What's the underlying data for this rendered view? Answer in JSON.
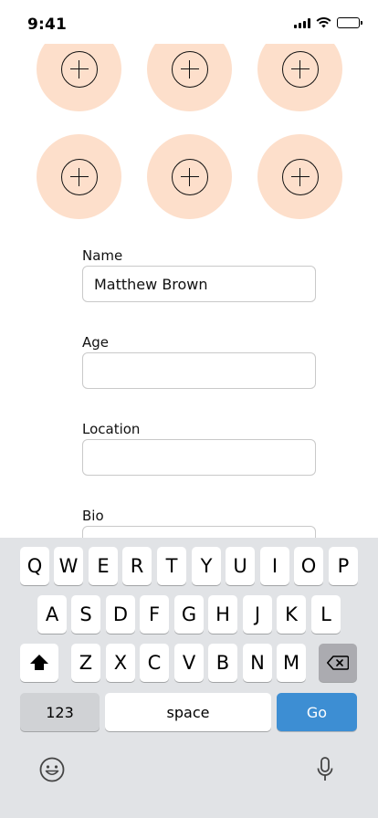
{
  "status_bar": {
    "time": "9:41"
  },
  "photo_slots": [
    {
      "icon": "plus-circle-icon"
    },
    {
      "icon": "plus-circle-icon"
    },
    {
      "icon": "plus-circle-icon"
    },
    {
      "icon": "plus-circle-icon"
    },
    {
      "icon": "plus-circle-icon"
    },
    {
      "icon": "plus-circle-icon"
    }
  ],
  "form": {
    "name": {
      "label": "Name",
      "value": "Matthew Brown",
      "placeholder": ""
    },
    "age": {
      "label": "Age",
      "value": "",
      "placeholder": ""
    },
    "location": {
      "label": "Location",
      "value": "",
      "placeholder": ""
    },
    "bio": {
      "label": "Bio",
      "value": "",
      "placeholder": ""
    }
  },
  "keyboard": {
    "row1": [
      "Q",
      "W",
      "E",
      "R",
      "T",
      "Y",
      "U",
      "I",
      "O",
      "P"
    ],
    "row2": [
      "A",
      "S",
      "D",
      "F",
      "G",
      "H",
      "J",
      "K",
      "L"
    ],
    "row3": [
      "Z",
      "X",
      "C",
      "V",
      "B",
      "N",
      "M"
    ],
    "numbers_label": "123",
    "space_label": "space",
    "go_label": "Go"
  },
  "colors": {
    "photo_slot_bg": "#fddfcb",
    "go_key": "#3d8ed3",
    "keyboard_bg": "#e1e3e6"
  }
}
